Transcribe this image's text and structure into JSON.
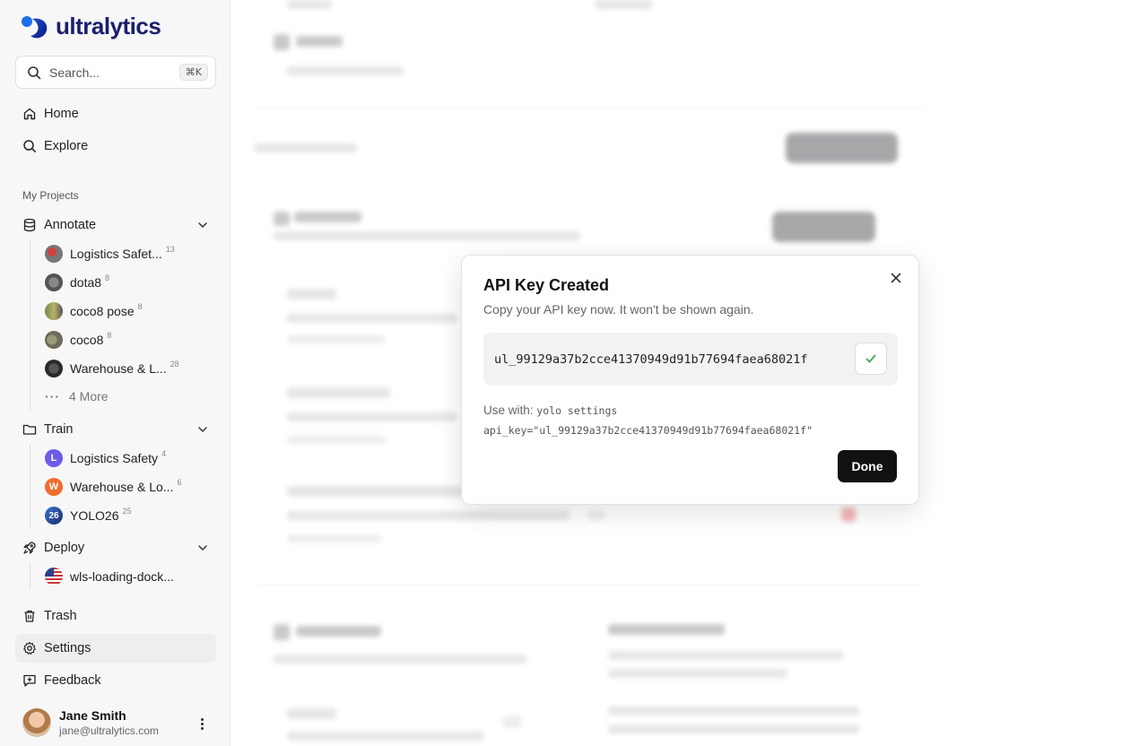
{
  "app": {
    "brand": "ultralytics",
    "brand_color": "#1b1f6b"
  },
  "search": {
    "placeholder": "Search...",
    "shortcut": "⌘K"
  },
  "nav": {
    "home": "Home",
    "explore": "Explore",
    "trash": "Trash",
    "settings": "Settings",
    "feedback": "Feedback"
  },
  "projects": {
    "section_label": "My Projects",
    "annotate": {
      "label": "Annotate",
      "items": [
        {
          "label": "Logistics Safet...",
          "count": "13"
        },
        {
          "label": "dota8",
          "count": "8"
        },
        {
          "label": "coco8 pose",
          "count": "8"
        },
        {
          "label": "coco8",
          "count": "8"
        },
        {
          "label": "Warehouse & L...",
          "count": "28"
        }
      ],
      "more": "4 More"
    },
    "train": {
      "label": "Train",
      "items": [
        {
          "label": "Logistics Safety",
          "count": "4",
          "avatar": "L",
          "color": "#6b5ce7"
        },
        {
          "label": "Warehouse & Lo...",
          "count": "6",
          "avatar": "W",
          "color": "#f26b2e"
        },
        {
          "label": "YOLO26",
          "count": "25",
          "avatar": "26",
          "color": "#2f5fa8"
        }
      ]
    },
    "deploy": {
      "label": "Deploy",
      "items": [
        {
          "label": "wls-loading-dock..."
        }
      ]
    }
  },
  "user": {
    "name": "Jane Smith",
    "email": "jane@ultralytics.com"
  },
  "modal": {
    "title": "API Key Created",
    "subtitle": "Copy your API key now. It won't be shown again.",
    "api_key": "ul_99129a37b2cce41370949d91b77694faea68021f",
    "usage_prefix": "Use with:",
    "usage_command": "yolo settings api_key=\"ul_99129a37b2cce41370949d91b77694faea68021f\"",
    "done_label": "Done"
  },
  "icons": {
    "search": "search-icon",
    "home": "home-icon",
    "explore": "search-icon",
    "annotate": "database-icon",
    "train": "folder-icon",
    "deploy": "rocket-icon",
    "trash": "trash-icon",
    "settings": "gear-icon",
    "feedback": "feedback-icon",
    "close": "close-icon",
    "copied": "check-icon"
  }
}
